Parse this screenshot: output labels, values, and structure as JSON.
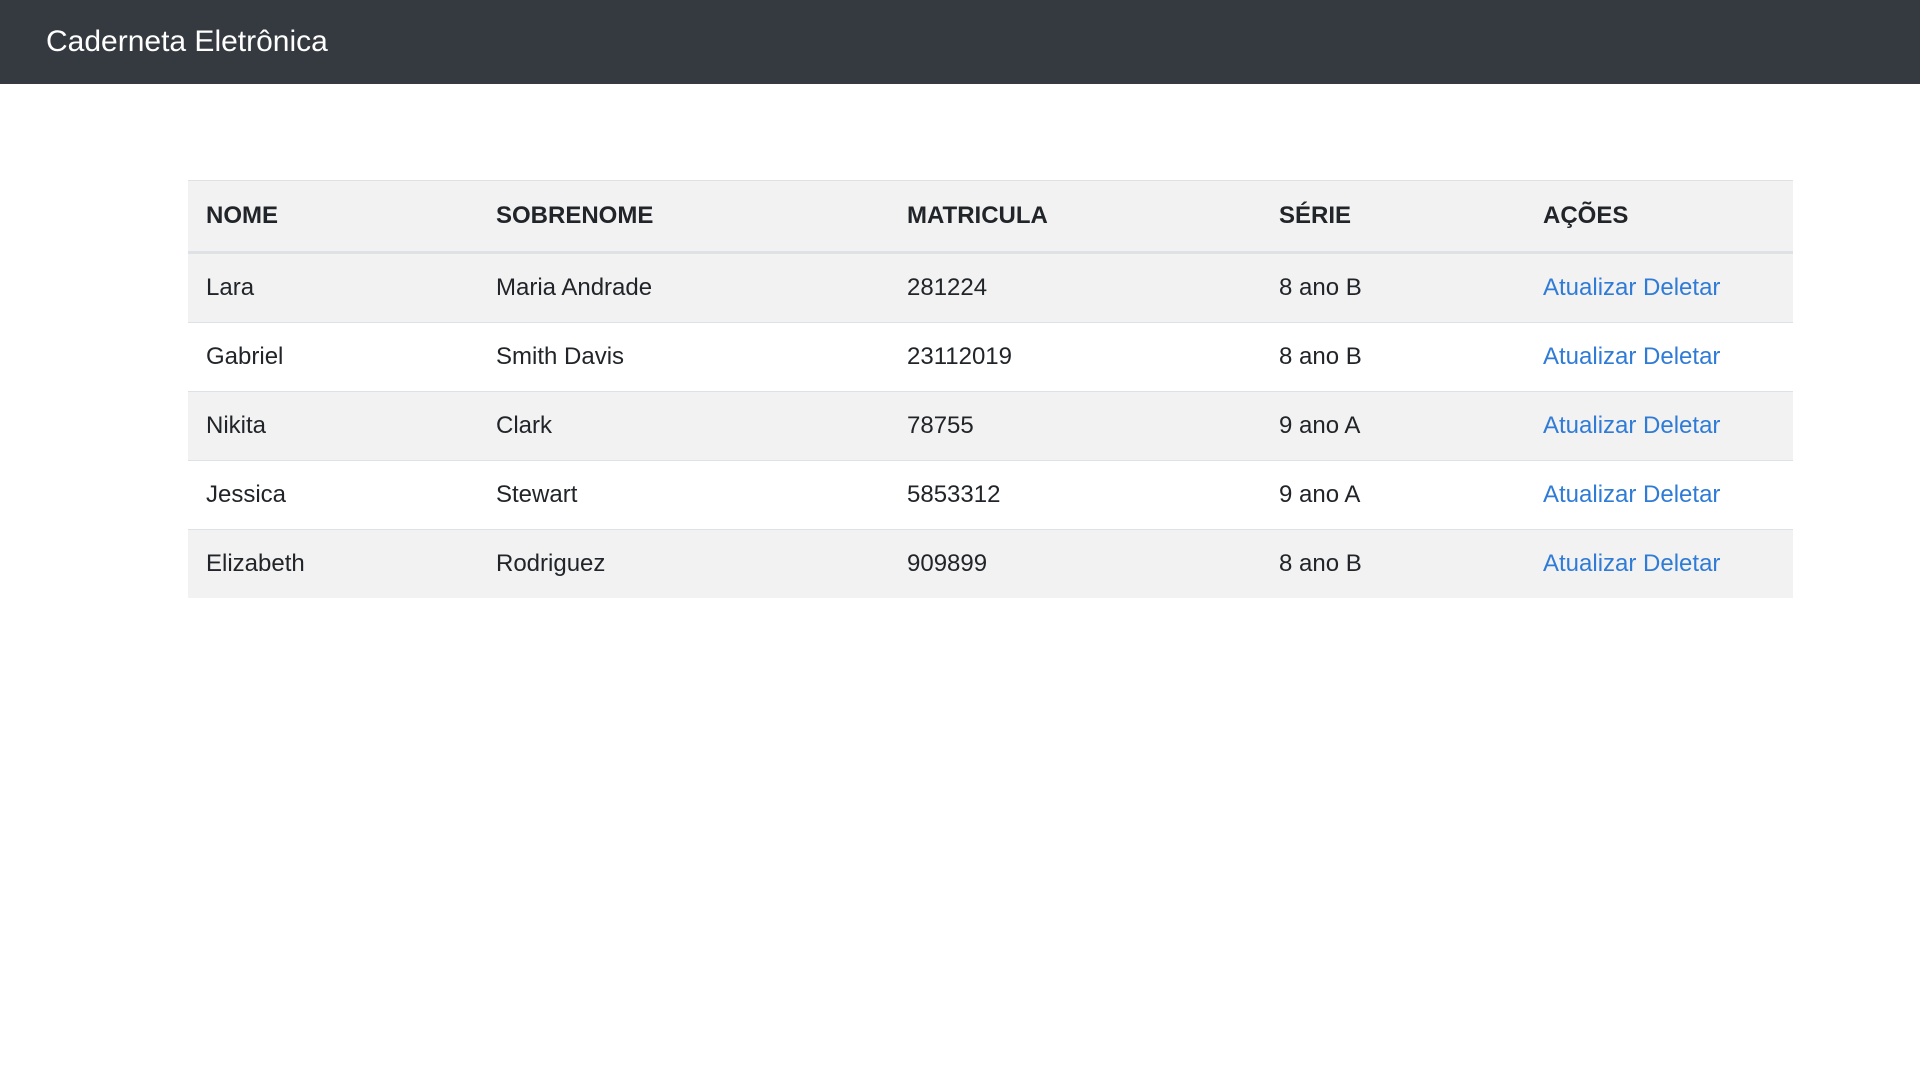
{
  "navbar": {
    "brand": "Caderneta Eletrônica"
  },
  "table": {
    "headers": {
      "nome": "NOME",
      "sobrenome": "SOBRENOME",
      "matricula": "MATRICULA",
      "serie": "SÉRIE",
      "acoes": "AÇÕES"
    },
    "rows": [
      {
        "nome": "Lara",
        "sobrenome": "Maria Andrade",
        "matricula": "281224",
        "serie": "8 ano B",
        "atualizar": "Atualizar",
        "deletar": "Deletar"
      },
      {
        "nome": "Gabriel",
        "sobrenome": "Smith Davis",
        "matricula": "23112019",
        "serie": "8 ano B",
        "atualizar": "Atualizar",
        "deletar": "Deletar"
      },
      {
        "nome": "Nikita",
        "sobrenome": "Clark",
        "matricula": "78755",
        "serie": "9 ano A",
        "atualizar": "Atualizar",
        "deletar": "Deletar"
      },
      {
        "nome": "Jessica",
        "sobrenome": "Stewart",
        "matricula": "5853312",
        "serie": "9 ano A",
        "atualizar": "Atualizar",
        "deletar": "Deletar"
      },
      {
        "nome": "Elizabeth",
        "sobrenome": "Rodriguez",
        "matricula": "909899",
        "serie": "8 ano B",
        "atualizar": "Atualizar",
        "deletar": "Deletar"
      }
    ]
  },
  "colors": {
    "navbar_bg": "#343a40",
    "link": "#2f7bd6",
    "stripe": "#f2f2f2"
  }
}
